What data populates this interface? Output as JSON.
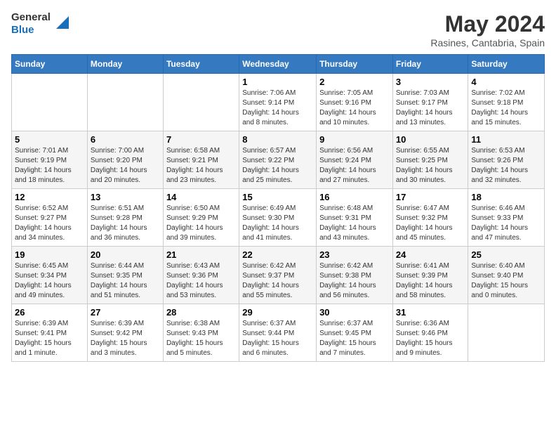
{
  "header": {
    "logo_line1": "General",
    "logo_line2": "Blue",
    "month_title": "May 2024",
    "location": "Rasines, Cantabria, Spain"
  },
  "days_of_week": [
    "Sunday",
    "Monday",
    "Tuesday",
    "Wednesday",
    "Thursday",
    "Friday",
    "Saturday"
  ],
  "weeks": [
    [
      {
        "day": "",
        "info": ""
      },
      {
        "day": "",
        "info": ""
      },
      {
        "day": "",
        "info": ""
      },
      {
        "day": "1",
        "info": "Sunrise: 7:06 AM\nSunset: 9:14 PM\nDaylight: 14 hours\nand 8 minutes."
      },
      {
        "day": "2",
        "info": "Sunrise: 7:05 AM\nSunset: 9:16 PM\nDaylight: 14 hours\nand 10 minutes."
      },
      {
        "day": "3",
        "info": "Sunrise: 7:03 AM\nSunset: 9:17 PM\nDaylight: 14 hours\nand 13 minutes."
      },
      {
        "day": "4",
        "info": "Sunrise: 7:02 AM\nSunset: 9:18 PM\nDaylight: 14 hours\nand 15 minutes."
      }
    ],
    [
      {
        "day": "5",
        "info": "Sunrise: 7:01 AM\nSunset: 9:19 PM\nDaylight: 14 hours\nand 18 minutes."
      },
      {
        "day": "6",
        "info": "Sunrise: 7:00 AM\nSunset: 9:20 PM\nDaylight: 14 hours\nand 20 minutes."
      },
      {
        "day": "7",
        "info": "Sunrise: 6:58 AM\nSunset: 9:21 PM\nDaylight: 14 hours\nand 23 minutes."
      },
      {
        "day": "8",
        "info": "Sunrise: 6:57 AM\nSunset: 9:22 PM\nDaylight: 14 hours\nand 25 minutes."
      },
      {
        "day": "9",
        "info": "Sunrise: 6:56 AM\nSunset: 9:24 PM\nDaylight: 14 hours\nand 27 minutes."
      },
      {
        "day": "10",
        "info": "Sunrise: 6:55 AM\nSunset: 9:25 PM\nDaylight: 14 hours\nand 30 minutes."
      },
      {
        "day": "11",
        "info": "Sunrise: 6:53 AM\nSunset: 9:26 PM\nDaylight: 14 hours\nand 32 minutes."
      }
    ],
    [
      {
        "day": "12",
        "info": "Sunrise: 6:52 AM\nSunset: 9:27 PM\nDaylight: 14 hours\nand 34 minutes."
      },
      {
        "day": "13",
        "info": "Sunrise: 6:51 AM\nSunset: 9:28 PM\nDaylight: 14 hours\nand 36 minutes."
      },
      {
        "day": "14",
        "info": "Sunrise: 6:50 AM\nSunset: 9:29 PM\nDaylight: 14 hours\nand 39 minutes."
      },
      {
        "day": "15",
        "info": "Sunrise: 6:49 AM\nSunset: 9:30 PM\nDaylight: 14 hours\nand 41 minutes."
      },
      {
        "day": "16",
        "info": "Sunrise: 6:48 AM\nSunset: 9:31 PM\nDaylight: 14 hours\nand 43 minutes."
      },
      {
        "day": "17",
        "info": "Sunrise: 6:47 AM\nSunset: 9:32 PM\nDaylight: 14 hours\nand 45 minutes."
      },
      {
        "day": "18",
        "info": "Sunrise: 6:46 AM\nSunset: 9:33 PM\nDaylight: 14 hours\nand 47 minutes."
      }
    ],
    [
      {
        "day": "19",
        "info": "Sunrise: 6:45 AM\nSunset: 9:34 PM\nDaylight: 14 hours\nand 49 minutes."
      },
      {
        "day": "20",
        "info": "Sunrise: 6:44 AM\nSunset: 9:35 PM\nDaylight: 14 hours\nand 51 minutes."
      },
      {
        "day": "21",
        "info": "Sunrise: 6:43 AM\nSunset: 9:36 PM\nDaylight: 14 hours\nand 53 minutes."
      },
      {
        "day": "22",
        "info": "Sunrise: 6:42 AM\nSunset: 9:37 PM\nDaylight: 14 hours\nand 55 minutes."
      },
      {
        "day": "23",
        "info": "Sunrise: 6:42 AM\nSunset: 9:38 PM\nDaylight: 14 hours\nand 56 minutes."
      },
      {
        "day": "24",
        "info": "Sunrise: 6:41 AM\nSunset: 9:39 PM\nDaylight: 14 hours\nand 58 minutes."
      },
      {
        "day": "25",
        "info": "Sunrise: 6:40 AM\nSunset: 9:40 PM\nDaylight: 15 hours\nand 0 minutes."
      }
    ],
    [
      {
        "day": "26",
        "info": "Sunrise: 6:39 AM\nSunset: 9:41 PM\nDaylight: 15 hours\nand 1 minute."
      },
      {
        "day": "27",
        "info": "Sunrise: 6:39 AM\nSunset: 9:42 PM\nDaylight: 15 hours\nand 3 minutes."
      },
      {
        "day": "28",
        "info": "Sunrise: 6:38 AM\nSunset: 9:43 PM\nDaylight: 15 hours\nand 5 minutes."
      },
      {
        "day": "29",
        "info": "Sunrise: 6:37 AM\nSunset: 9:44 PM\nDaylight: 15 hours\nand 6 minutes."
      },
      {
        "day": "30",
        "info": "Sunrise: 6:37 AM\nSunset: 9:45 PM\nDaylight: 15 hours\nand 7 minutes."
      },
      {
        "day": "31",
        "info": "Sunrise: 6:36 AM\nSunset: 9:46 PM\nDaylight: 15 hours\nand 9 minutes."
      },
      {
        "day": "",
        "info": ""
      }
    ]
  ]
}
